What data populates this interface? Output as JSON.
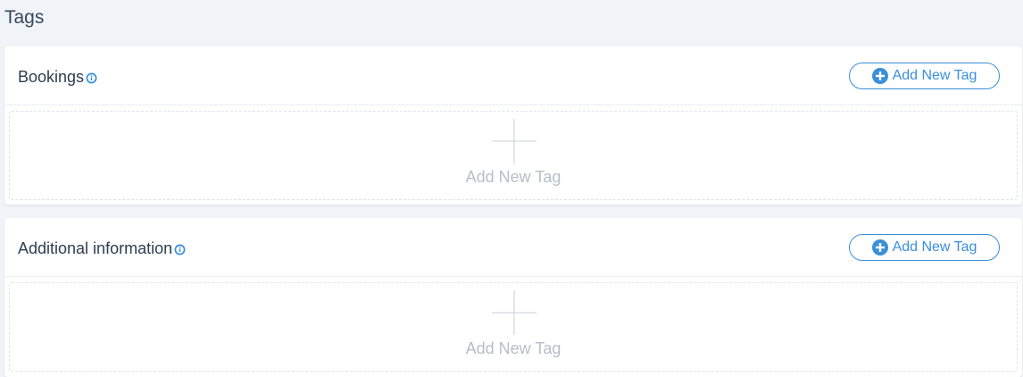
{
  "page": {
    "title": "Tags"
  },
  "sections": [
    {
      "title": "Bookings",
      "info_icon": "info-circle-icon",
      "add_button_label": "Add New Tag",
      "dropzone_label": "Add New Tag"
    },
    {
      "title": "Additional information",
      "info_icon": "info-circle-icon",
      "add_button_label": "Add New Tag",
      "dropzone_label": "Add New Tag"
    }
  ],
  "colors": {
    "accent": "#3b8fd9",
    "background": "#f0f3f7",
    "placeholder_text": "#b6bec8"
  }
}
